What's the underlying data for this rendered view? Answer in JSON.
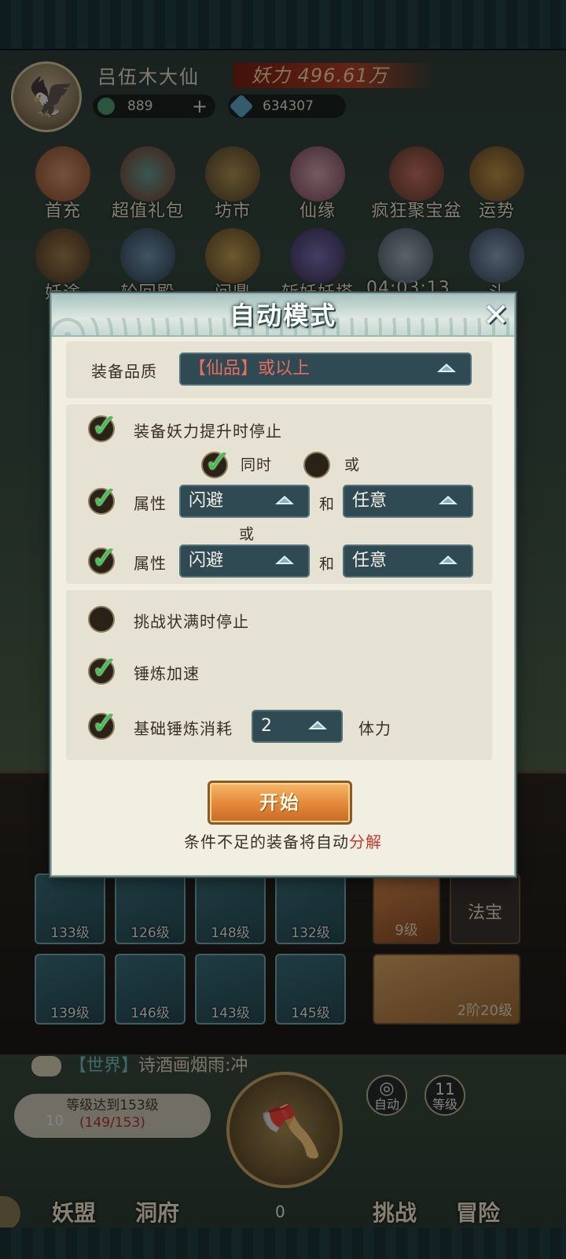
{
  "player": {
    "name": "吕伍木大仙",
    "power": "妖力 496.61万",
    "currency_jade": "889",
    "currency_jade_plus": "+",
    "currency_gem": "634307"
  },
  "menu_row1": [
    "首充",
    "超值礼包",
    "坊市",
    "仙缘",
    "疯狂聚宝盆",
    "运势"
  ],
  "menu_row2": [
    "妖途",
    "轮回殿",
    "问鼎",
    "斩妖妖塔",
    "04:03:13",
    "斗"
  ],
  "equipment": [
    {
      "level": "133级"
    },
    {
      "level": "126级"
    },
    {
      "level": "148级"
    },
    {
      "level": "132级"
    },
    {
      "level": "139级"
    },
    {
      "level": "146级"
    },
    {
      "level": "143级"
    },
    {
      "level": "145级"
    }
  ],
  "side_panel": {
    "pet_level": "9级",
    "fabao_label": "法宝",
    "weapon_level": "2阶20级"
  },
  "chat": {
    "channel": "【世界】",
    "message": "诗酒画烟雨:冲"
  },
  "level_task": {
    "title": "等级达到153级",
    "progress": "(149/153)",
    "number": "10"
  },
  "bottom_buttons": {
    "auto": "自动",
    "level_num": "11",
    "level": "等级",
    "coins": "0"
  },
  "bottom_nav": [
    "妖盟",
    "洞府",
    "挑战",
    "冒险"
  ],
  "modal": {
    "title": "自动模式",
    "close": "✕",
    "quality_label": "装备品质",
    "quality_value_open": "【",
    "quality_value_main": "仙品",
    "quality_value_close": "】",
    "quality_value_suffix": "或以上",
    "stop_on_power_up": "装备妖力提升时停止",
    "simultaneous": "同时",
    "or_option": "或",
    "attr_label_1": "属性",
    "attr1_value": "闪避",
    "and_1": "和",
    "attr1_second": "任意",
    "or_between": "或",
    "attr_label_2": "属性",
    "attr2_value": "闪避",
    "and_2": "和",
    "attr2_second": "任意",
    "stop_on_full_challenge": "挑战状满时停止",
    "forge_speedup": "锤炼加速",
    "base_cost_label": "基础锤炼消耗",
    "base_cost_value": "2",
    "stamina": "体力",
    "start": "开始",
    "note_prefix": "条件不足的装备将自动",
    "note_highlight": "分解"
  },
  "checkbox_states": {
    "stop_on_power_up": true,
    "simultaneous": true,
    "or_option": false,
    "attr1": true,
    "attr2": true,
    "stop_on_full_challenge": false,
    "forge_speedup": true,
    "base_cost": true
  },
  "colors": {
    "modal_bg": "#f1eee2",
    "dropdown_bg": "#2f4a52",
    "check_green": "#3ec447",
    "start_button": "#e3873a",
    "highlight_red": "#c23b2f"
  }
}
